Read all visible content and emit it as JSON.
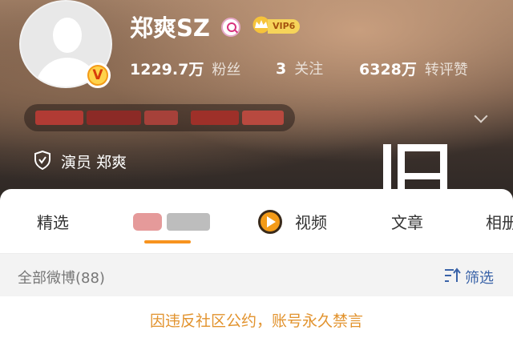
{
  "profile": {
    "name": "郑爽SZ",
    "vip_label": "VIP6",
    "stats": [
      {
        "value": "1229.7万",
        "label": "粉丝"
      },
      {
        "value": "3",
        "label": "关注"
      },
      {
        "value": "6328万",
        "label": "转评赞"
      }
    ],
    "verification": "演员 郑爽",
    "overlay_text": "旧"
  },
  "tabs": [
    {
      "label": "精选"
    },
    {
      "label": ""
    },
    {
      "label": "视频"
    },
    {
      "label": "文章"
    },
    {
      "label": "相册"
    }
  ],
  "feed": {
    "all_posts_label": "全部微博(88)",
    "filter_label": "筛选",
    "ban_notice": "因违反社区公约，账号永久禁言"
  },
  "colors": {
    "accent_orange": "#f7931e",
    "notice_orange": "#e2932e",
    "filter_blue": "#3a63a8"
  },
  "icons": [
    "avatar-placeholder",
    "verified-v-icon",
    "search-badge-icon",
    "vip-crown-icon",
    "chevron-down-icon",
    "shield-icon",
    "video-play-icon",
    "filter-icon"
  ]
}
